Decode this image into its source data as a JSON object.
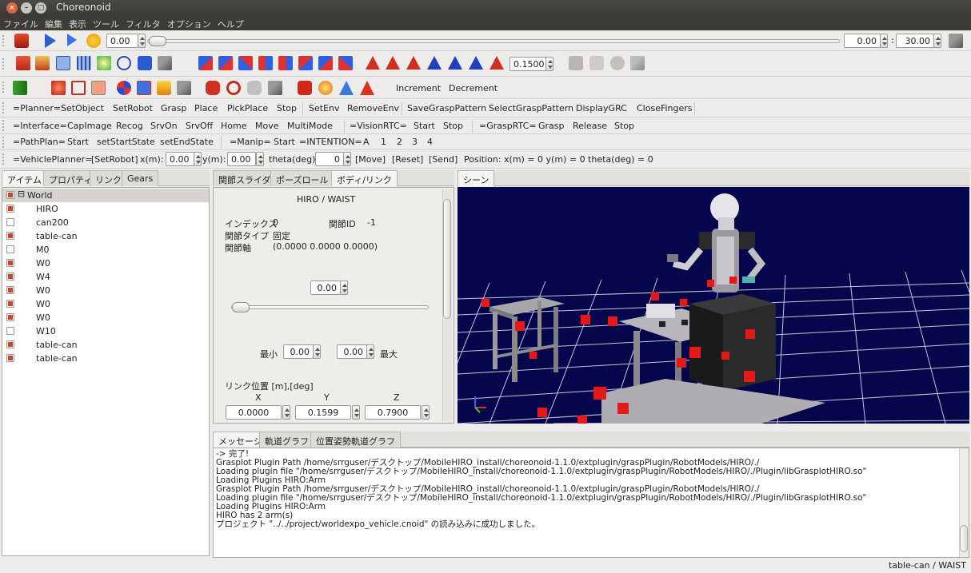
{
  "window": {
    "title": "Choreonoid"
  },
  "menu": [
    "ファイル",
    "編集",
    "表示",
    "ツール",
    "フィルタ",
    "オプション",
    "ヘルプ"
  ],
  "timebar": {
    "time": "0.00",
    "min": "0.00",
    "max": "30.00"
  },
  "kinematics": {
    "value": "0.1500"
  },
  "body_toolbar": {
    "increment": "Increment",
    "decrement": "Decrement"
  },
  "planner": {
    "label": "=Planner=",
    "items": [
      "SetObject",
      "SetRobot",
      "Grasp",
      "Place",
      "PickPlace",
      "Stop",
      "SetEnv",
      "RemoveEnv",
      "SaveGraspPattern",
      "SelectGraspPattern",
      "DisplayGRC",
      "CloseFingers"
    ]
  },
  "interface": {
    "label": "=Interface=",
    "items": [
      "CapImage",
      "Recog",
      "SrvOn",
      "SrvOff",
      "Home",
      "Move",
      "MultiMode"
    ],
    "vision_label": "=VisionRTC=",
    "vision_items": [
      "Start",
      "Stop"
    ],
    "grasp_label": "=GraspRTC=",
    "grasp_items": [
      "Grasp",
      "Release",
      "Stop"
    ]
  },
  "pathplan": {
    "label": "=PathPlan=",
    "items": [
      "Start",
      "setStartState",
      "setEndState"
    ],
    "manip_label": "=Manip=",
    "manip_items": [
      "Start"
    ],
    "intention_label": "=INTENTION=",
    "intention_items": [
      "A",
      "1",
      "2",
      "3",
      "4"
    ]
  },
  "vehicle": {
    "label": "=VehiclePlanner=",
    "setrobot": "[SetRobot]",
    "x_label": "x(m):",
    "x": "0.00",
    "y_label": "y(m):",
    "y": "0.00",
    "theta_label": "theta(deg):",
    "theta": "0",
    "move": "[Move]",
    "reset": "[Reset]",
    "send": "[Send]",
    "position": "Position: x(m) = 0 y(m) = 0 theta(deg) = 0"
  },
  "left_tabs": [
    "アイテム",
    "プロパティ",
    "リンク",
    "Gears"
  ],
  "tree": [
    {
      "label": "World",
      "checked": true,
      "root": true
    },
    {
      "label": "HIRO",
      "checked": true
    },
    {
      "label": "can200",
      "checked": false
    },
    {
      "label": "table-can",
      "checked": true
    },
    {
      "label": "M0",
      "checked": false
    },
    {
      "label": "W0",
      "checked": true
    },
    {
      "label": "W4",
      "checked": true
    },
    {
      "label": "W0",
      "checked": true
    },
    {
      "label": "W0",
      "checked": true
    },
    {
      "label": "W0",
      "checked": true
    },
    {
      "label": "W10",
      "checked": false
    },
    {
      "label": "table-can",
      "checked": true
    },
    {
      "label": "table-can",
      "checked": true
    }
  ],
  "mid_tabs": [
    "関節スライダ",
    "ポーズロール",
    "ボディ/リンク"
  ],
  "link": {
    "title": "HIRO / WAIST",
    "index_label": "インデックス",
    "index": "0",
    "joint_id_label": "関節ID",
    "joint_id": "-1",
    "joint_type_label": "関節タイプ",
    "joint_type": "固定",
    "joint_axis_label": "関節軸",
    "joint_axis": "(0.0000 0.0000 0.0000)",
    "value": "0.00",
    "min_label": "最小",
    "min": "0.00",
    "max": "0.00",
    "max_label": "最大",
    "pos_label": "リンク位置 [m],[deg]",
    "x_label": "X",
    "y_label": "Y",
    "z_label": "Z",
    "x": "0.0000",
    "y": "0.1599",
    "z": "0.7900"
  },
  "scene_tab": "シーン",
  "msg_tabs": [
    "メッセージ",
    "軌道グラフ",
    "位置姿勢軌道グラフ"
  ],
  "messages": [
    "-> 完了!",
    "Grasplot Plugin Path /home/srrguser/デスクトップ/MobileHIRO_install/choreonoid-1.1.0/extplugin/graspPlugin/RobotModels/HIRO/./",
    "Loading plugin file \"/home/srrguser/デスクトップ/MobileHIRO_install/choreonoid-1.1.0/extplugin/graspPlugin/RobotModels/HIRO/./Plugin/libGrasplotHIRO.so\"",
    "Loading Plugins HIRO:Arm",
    "Grasplot Plugin Path /home/srrguser/デスクトップ/MobileHIRO_install/choreonoid-1.1.0/extplugin/graspPlugin/RobotModels/HIRO/./",
    "Loading plugin file \"/home/srrguser/デスクトップ/MobileHIRO_install/choreonoid-1.1.0/extplugin/graspPlugin/RobotModels/HIRO/./Plugin/libGrasplotHIRO.so\"",
    "Loading Plugins HIRO:Arm",
    "HIRO has 2 arm(s)",
    "プロジェクト \"../../project/worldexpo_vehicle.cnoid\" の読み込みに成功しました。"
  ],
  "status": "table-can / WAIST",
  "colors": {
    "accent": "#c8462e",
    "viewport": "#06064d"
  }
}
